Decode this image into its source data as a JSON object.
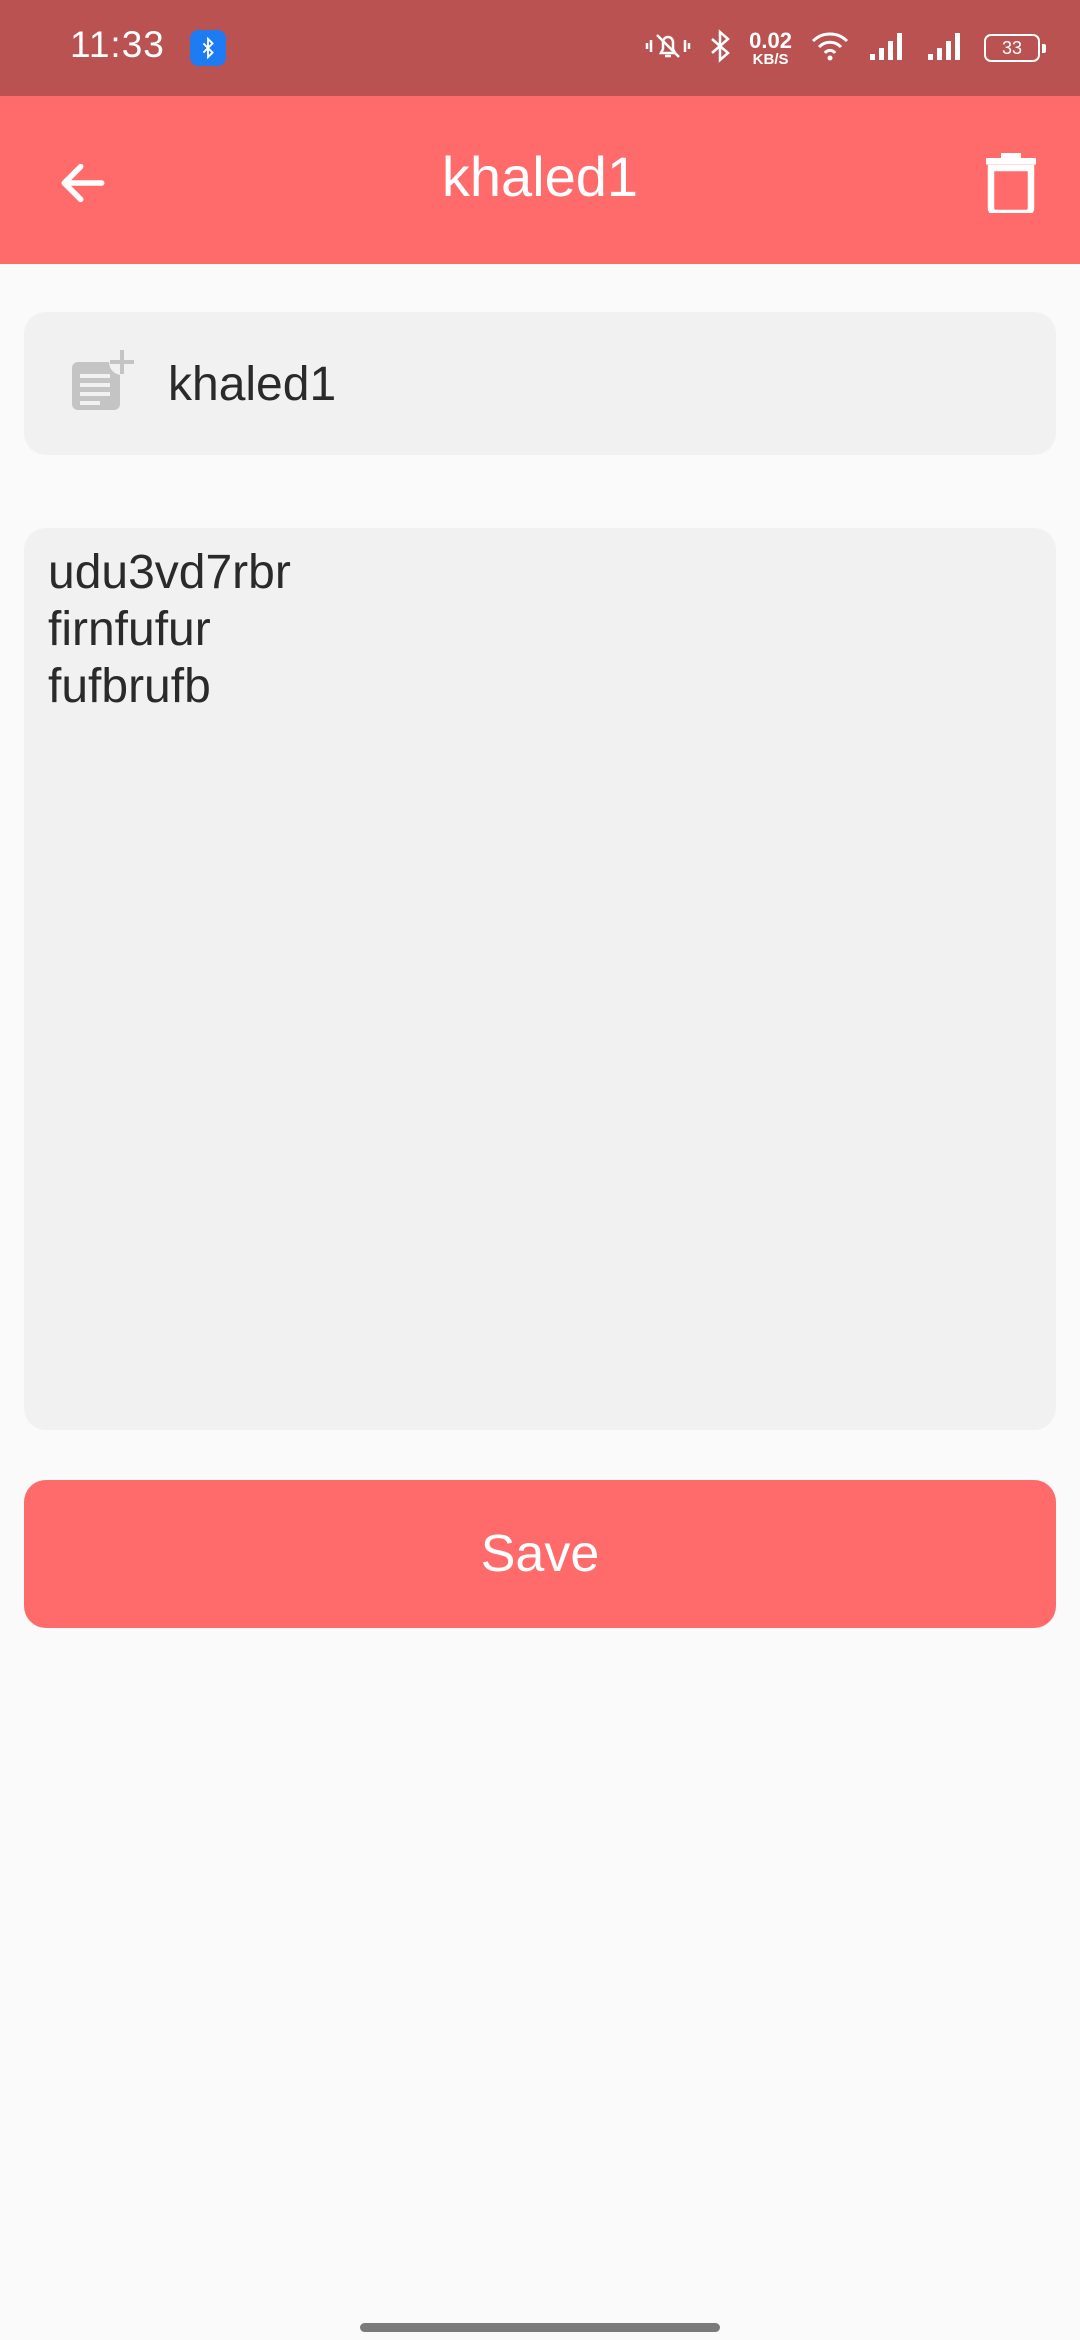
{
  "status_bar": {
    "time": "11:33",
    "net_speed_value": "0.02",
    "net_speed_unit": "KB/S",
    "battery_level": "33",
    "icons": [
      "bluetooth-app-icon",
      "mute-vibrate-icon",
      "bluetooth-icon",
      "wifi-icon",
      "signal-icon",
      "signal-icon",
      "battery-icon"
    ]
  },
  "app_bar": {
    "title": "khaled1",
    "back_icon": "arrow-left-icon",
    "delete_icon": "trash-icon",
    "color": "#ff6b6b"
  },
  "form": {
    "title_value": "khaled1",
    "title_icon": "note-add-icon",
    "content_value": "udu3vd7rbr\nfirnfufur\nfufbrufb",
    "save_label": "Save"
  },
  "colors": {
    "status_bar": "#bb5252",
    "accent": "#ff6b6b",
    "field_bg": "#f1f1f1",
    "page_bg": "#fafafa"
  }
}
